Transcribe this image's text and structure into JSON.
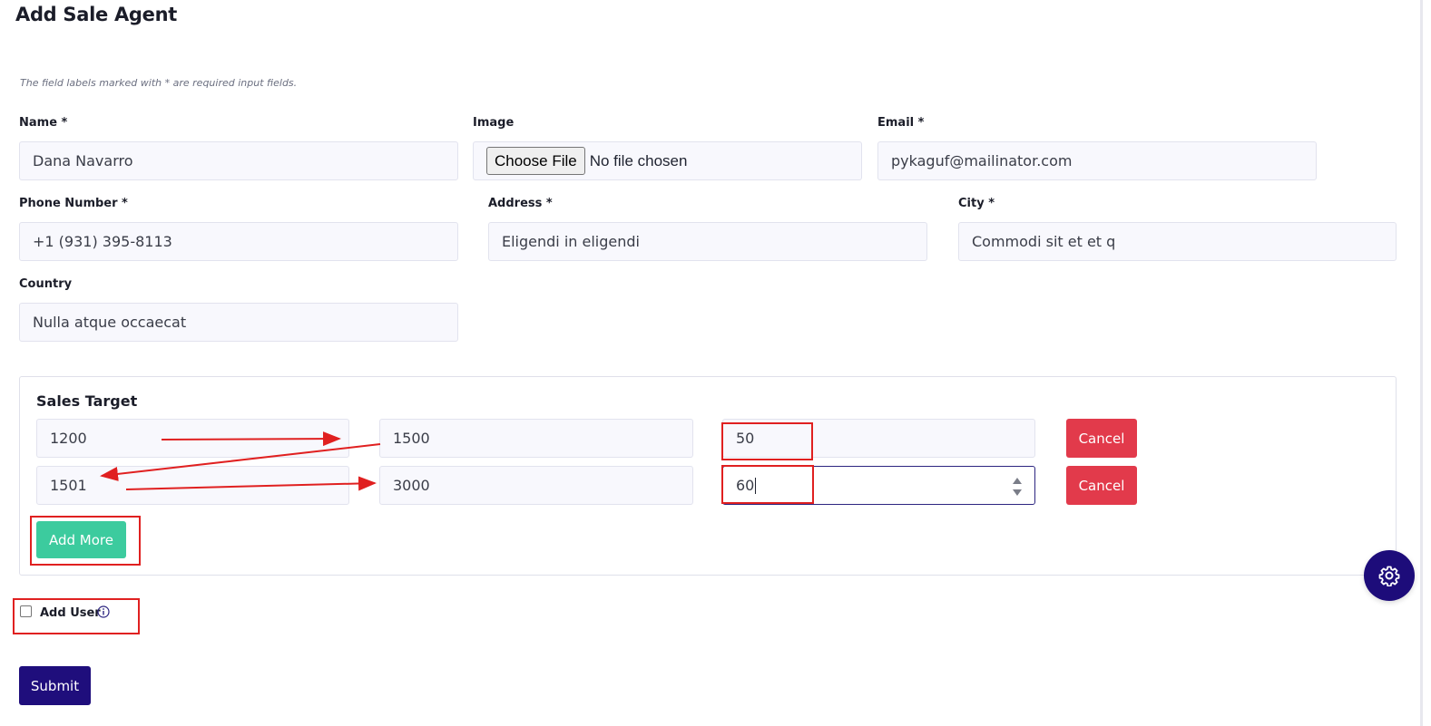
{
  "page": {
    "title": "Add Sale Agent",
    "required_note": "The field labels marked with * are required input fields."
  },
  "form": {
    "name": {
      "label": "Name *",
      "value": "Dana Navarro"
    },
    "image": {
      "label": "Image",
      "button": "Choose File",
      "status": "No file chosen"
    },
    "email": {
      "label": "Email *",
      "value": "pykaguf@mailinator.com"
    },
    "phone": {
      "label": "Phone Number *",
      "value": "+1 (931) 395-8113"
    },
    "address": {
      "label": "Address *",
      "value": "Eligendi in eligendi"
    },
    "city": {
      "label": "City *",
      "value": "Commodi sit et et q"
    },
    "country": {
      "label": "Country",
      "value": "Nulla atque occaecat"
    }
  },
  "sales_target": {
    "title": "Sales Target",
    "rows": [
      {
        "from": "1200",
        "to": "1500",
        "value": "50",
        "cancel": "Cancel"
      },
      {
        "from": "1501",
        "to": "3000",
        "value": "60",
        "cancel": "Cancel"
      }
    ],
    "add_more": "Add More"
  },
  "add_user": {
    "label": "Add User",
    "checked": false
  },
  "submit": "Submit",
  "icons": [
    "gear-icon",
    "info-icon",
    "spinner-icon"
  ],
  "colors": {
    "primary": "#1f0e7c",
    "cancel": "#e23a4b",
    "add_more": "#3ccb9e",
    "annotation": "#e02020"
  }
}
